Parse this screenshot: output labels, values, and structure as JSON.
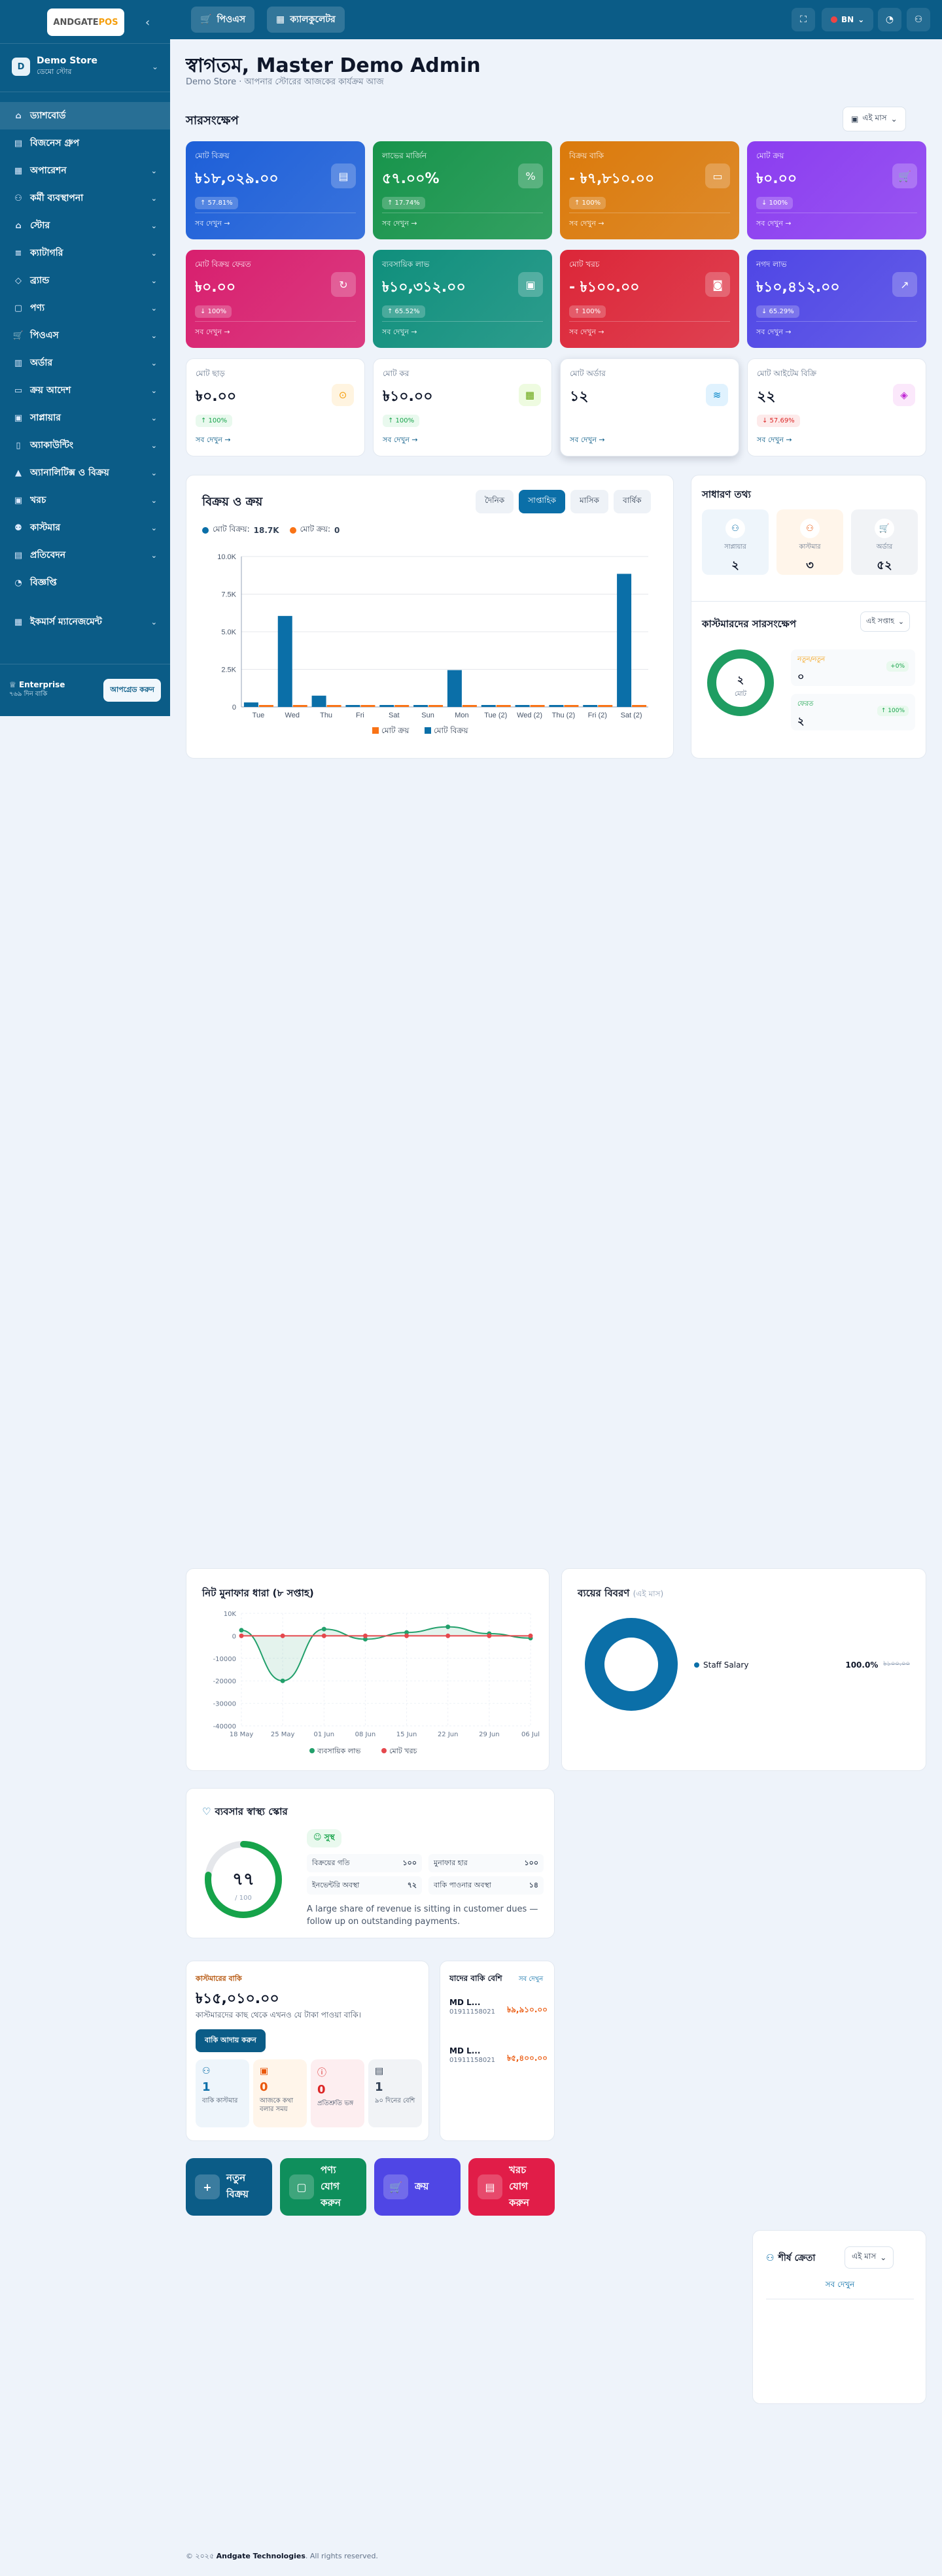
{
  "sidebar": {
    "logo_text": "ANDGATE",
    "logo_accent": "POS",
    "store": {
      "avatar": "D",
      "name": "Demo Store",
      "type": "ডেমো স্টোর"
    },
    "items": [
      {
        "label": "ড্যাশবোর্ড",
        "icon": "home-icon",
        "active": true,
        "chevron": false
      },
      {
        "label": "বিজনেস গ্রুপ",
        "icon": "building-icon",
        "chevron": false
      },
      {
        "label": "অপারেশন",
        "icon": "grid-icon",
        "chevron": true
      },
      {
        "label": "কর্মী ব্যবস্থাপনা",
        "icon": "users-icon",
        "chevron": true
      },
      {
        "label": "স্টোর",
        "icon": "store-icon",
        "chevron": true
      },
      {
        "label": "ক্যাটাগরি",
        "icon": "layers-icon",
        "chevron": true
      },
      {
        "label": "ব্র্যান্ড",
        "icon": "tag-icon",
        "chevron": true
      },
      {
        "label": "পণ্য",
        "icon": "box-icon",
        "chevron": true
      },
      {
        "label": "পিওএস",
        "icon": "cart-icon",
        "chevron": true
      },
      {
        "label": "অর্ডার",
        "icon": "clipboard-icon",
        "chevron": true
      },
      {
        "label": "ক্রয় আদেশ",
        "icon": "truck-icon",
        "chevron": true
      },
      {
        "label": "সাপ্লায়ার",
        "icon": "supplier-icon",
        "chevron": true
      },
      {
        "label": "অ্যাকাউন্টিং",
        "icon": "book-icon",
        "chevron": true
      },
      {
        "label": "অ্যানালিটিক্স ও বিক্রয়",
        "icon": "chart-icon",
        "chevron": true
      },
      {
        "label": "খরচ",
        "icon": "wallet-icon",
        "chevron": true
      },
      {
        "label": "কাস্টমার",
        "icon": "customer-icon",
        "chevron": true
      },
      {
        "label": "প্রতিবেদন",
        "icon": "report-icon",
        "chevron": true
      },
      {
        "label": "বিজ্ঞপ্তি",
        "icon": "bell-icon",
        "chevron": false
      },
      {
        "label": "ইকমার্স ম্যানেজমেন্ট",
        "icon": "ecommerce-icon",
        "chevron": true
      }
    ],
    "plan": {
      "title": "Enterprise",
      "subtitle": "৭৬৯ দিন বাকি",
      "upgrade_label": "আপগ্রেড করুন"
    }
  },
  "topbar": {
    "pos_label": "পিওএস",
    "calc_label": "ক্যালকুলেটর",
    "lang": "BN"
  },
  "header": {
    "title": "স্বাগতম, Master Demo Admin",
    "subtitle": "Demo Store · আপনার স্টোরের আজকের কার্যক্রম আজ"
  },
  "summary": {
    "title": "সারসংক্ষেপ",
    "period": "এই মাস",
    "kpis": [
      {
        "label": "মোট বিক্রয়",
        "value": "৳১৮,০২৯.০০",
        "badge": "↑ 57.81%",
        "more": "সব দেখুন →",
        "color": "#1d5fd8",
        "icon": "receipt-icon"
      },
      {
        "label": "লাভের মার্জিন",
        "value": "৫৭.০০%",
        "badge": "↑ 17.74%",
        "more": "সব দেখুন →",
        "color": "#17944b",
        "icon": "percent-icon"
      },
      {
        "label": "বিক্রয় বাকি",
        "value": "- ৳৭,৮১০.০০",
        "badge": "↑ 100%",
        "more": "সব দেখুন →",
        "color": "#db7a0b",
        "icon": "card-icon"
      },
      {
        "label": "মোট ক্রয়",
        "value": "৳০.০০",
        "badge": "↓ 100%",
        "more": "সব দেখুন →",
        "color": "#8b3df0",
        "icon": "cart-icon"
      },
      {
        "label": "মোট বিক্রয় ফেরত",
        "value": "৳০.০০",
        "badge": "↓ 100%",
        "more": "সব দেখুন →",
        "color": "#d81f6e",
        "icon": "refresh-icon"
      },
      {
        "label": "ব্যবসায়িক লাভ",
        "value": "৳১০,৩১২.০০",
        "badge": "↑ 65.52%",
        "more": "সব দেখুন →",
        "color": "#0f8f7c",
        "icon": "wallet-icon"
      },
      {
        "label": "মোট খরচ",
        "value": "- ৳১০০.০০",
        "badge": "↑ 100%",
        "more": "সব দেখুন →",
        "color": "#dc2638",
        "icon": "money-icon"
      },
      {
        "label": "নগদ লাভ",
        "value": "৳১০,৪১২.০০",
        "badge": "↓ 65.29%",
        "more": "সব দেখুন →",
        "color": "#4f46e5",
        "icon": "trend-icon"
      }
    ],
    "white_kpis": [
      {
        "label": "মোট ছাড়",
        "value": "৳০.০০",
        "badge": "↑ 100%",
        "more": "সব দেখুন →",
        "badge_bg": "#e9f9ee",
        "badge_fg": "#16a34a",
        "icon": "discount-icon",
        "icon_bg": "#fff4e0",
        "icon_fg": "#f59e0b"
      },
      {
        "label": "মোট কর",
        "value": "৳১০.০০",
        "badge": "↑ 100%",
        "more": "সব দেখুন →",
        "badge_bg": "#e9f9ee",
        "badge_fg": "#16a34a",
        "icon": "tax-icon",
        "icon_bg": "#eefbe0",
        "icon_fg": "#65a30d"
      },
      {
        "label": "মোট অর্ডার",
        "value": "১২",
        "badge": "",
        "more": "সব দেখুন →",
        "badge_bg": "",
        "badge_fg": "",
        "icon": "stack-icon",
        "icon_bg": "#e0f2fe",
        "icon_fg": "#0284c7"
      },
      {
        "label": "মোট আইটেম বিক্রি",
        "value": "২২",
        "badge": "↓ 57.69%",
        "more": "সব দেখুন →",
        "badge_bg": "#fdeaea",
        "badge_fg": "#dc2626",
        "icon": "cube-icon",
        "icon_bg": "#fbe8fb",
        "icon_fg": "#c026d3"
      }
    ]
  },
  "sales_chart": {
    "title": "বিক্রয় ও ক্রয়",
    "tabs": [
      "দৈনিক",
      "সাপ্তাহিক",
      "মাসিক",
      "বার্ষিক"
    ],
    "active_tab": 1,
    "legend_sales_label": "মোট বিক্রয়:",
    "legend_sales_value": "18.7K",
    "legend_purchase_label": "মোট ক্রয়:",
    "legend_purchase_value": "0",
    "bottom_legend_purchase": "মোট ক্রয়",
    "bottom_legend_sales": "মোট বিক্রয়"
  },
  "chart_data": [
    {
      "type": "bar",
      "categories": [
        "Tue",
        "Wed",
        "Thu",
        "Fri",
        "Sat",
        "Sun",
        "Mon",
        "Tue (2)",
        "Wed (2)",
        "Thu (2)",
        "Fri (2)",
        "Sat (2)"
      ],
      "series": [
        {
          "name": "মোট বিক্রয়",
          "values": [
            300,
            6050,
            750,
            0,
            0,
            0,
            2450,
            0,
            0,
            0,
            0,
            8850
          ],
          "color": "#0b6fa8"
        },
        {
          "name": "মোট ক্রয়",
          "values": [
            0,
            0,
            0,
            0,
            0,
            0,
            0,
            0,
            0,
            0,
            0,
            0
          ],
          "color": "#f97316"
        }
      ],
      "yticks": [
        "0",
        "2.5K",
        "5.0K",
        "7.5K",
        "10.0K"
      ],
      "ylim": [
        0,
        10000
      ]
    },
    {
      "type": "line",
      "title": "নিট মুনাফার ধারা (৮ সপ্তাহ)",
      "categories": [
        "18 May",
        "25 May",
        "01 Jun",
        "08 Jun",
        "15 Jun",
        "22 Jun",
        "29 Jun",
        "06 Jul"
      ],
      "series": [
        {
          "name": "ব্যবসায়িক লাভ",
          "values": [
            2500,
            -20000,
            3000,
            -1500,
            1500,
            4000,
            1000,
            -1000
          ],
          "color": "#22a06b"
        },
        {
          "name": "মোট খরচ",
          "values": [
            0,
            0,
            0,
            0,
            0,
            0,
            0,
            0
          ],
          "color": "#e5484d"
        }
      ],
      "yticks": [
        "-40000",
        "-30000",
        "-20000",
        "-10000",
        "0",
        "10K"
      ],
      "ylim": [
        -40000,
        10000
      ]
    },
    {
      "type": "pie",
      "title": "ব্যয়ের বিবরণ",
      "labels": [
        "Staff Salary"
      ],
      "values": [
        100
      ],
      "colors": [
        "#0b6fa8"
      ]
    }
  ],
  "general_info": {
    "title": "সাধারণ তথ্য",
    "items": [
      {
        "label": "সাপ্লায়ার",
        "value": "২",
        "icon": "users-icon",
        "bg": "#eef5fb",
        "fg": "#0b6fa8"
      },
      {
        "label": "কাস্টমার",
        "value": "৩",
        "icon": "user-plus-icon",
        "bg": "#fff5ea",
        "fg": "#ea580c"
      },
      {
        "label": "অর্ডার",
        "value": "৫২",
        "icon": "cart-icon",
        "bg": "#f1f3f6",
        "fg": "#64748b"
      }
    ]
  },
  "customer_summary": {
    "title": "কাস্টমারদের সারসংক্ষেপ",
    "period": "এই সপ্তাহ",
    "total": "২",
    "total_label": "মোট",
    "rows": [
      {
        "label": "নতুন/নতুন",
        "value": "০",
        "badge": "+0%",
        "color": "#f59e0b"
      },
      {
        "label": "ফেরত",
        "value": "২",
        "badge": "↑ 100%",
        "color": "#16a34a"
      }
    ]
  },
  "profit_trend": {
    "title": "নিট মুনাফার ধারা (৮ সপ্তাহ)",
    "legend_profit": "ব্যবসায়িক লাভ",
    "legend_expense": "মোট খরচ"
  },
  "expense_breakdown": {
    "title": "ব্যয়ের বিবরণ",
    "period": "(এই মাস)",
    "item_label": "Staff Salary",
    "item_percent": "100.0%",
    "item_amount": "৳১০০.০০"
  },
  "health": {
    "title": "ব্যবসার স্বাস্থ্য স্কোর",
    "score": "৭৭",
    "score_sub": "/ 100",
    "status": "সুস্থ",
    "metrics": [
      {
        "label": "বিক্রয়ের গতি",
        "value": "১০০"
      },
      {
        "label": "মুনাফার হার",
        "value": "১০০"
      },
      {
        "label": "ইনভেন্টরি অবস্থা",
        "value": "৭২"
      },
      {
        "label": "বাকি পাওনার অবস্থা",
        "value": "১৪"
      }
    ],
    "note": "A large share of revenue is sitting in customer dues — follow up on outstanding payments."
  },
  "dues": {
    "tag": "কাস্টমারের বাকি",
    "amount": "৳১৫,০১০.০০",
    "desc": "কাস্টমারদের কাছ থেকে এখনও যে টাকা পাওয়া বাকি।",
    "button": "বাকি আদায় করুন",
    "stats": [
      {
        "value": "1",
        "label": "বাকি কাস্টমার",
        "bg": "#eef5fb",
        "fg": "#0b6fa8",
        "icon": "user-icon"
      },
      {
        "value": "0",
        "label": "আজকে কথা বলার সময়",
        "bg": "#fff5ea",
        "fg": "#ea580c",
        "icon": "calendar-icon"
      },
      {
        "value": "0",
        "label": "প্রতিশ্রুতি ভঙ্গ",
        "bg": "#fdeef0",
        "fg": "#dc2626",
        "icon": "alert-icon"
      },
      {
        "value": "1",
        "label": "৯০ দিনের বেশি",
        "bg": "#f1f3f6",
        "fg": "#334155",
        "icon": "archive-icon"
      }
    ]
  },
  "top_dues": {
    "title": "যাদের বাকি বেশি",
    "link": "সব দেখুন",
    "rows": [
      {
        "name": "MD L...",
        "phone": "01911158021",
        "amount": "৳৯,৯১০.০০"
      },
      {
        "name": "MD L...",
        "phone": "01911158021",
        "amount": "৳৫,৪০০.০০"
      }
    ]
  },
  "quick_actions": [
    {
      "label": "নতুন বিক্রয়",
      "icon": "plus-icon",
      "color": "#0b5c87"
    },
    {
      "label": "পণ্য যোগ করুন",
      "icon": "box-icon",
      "color": "#0f8f5c"
    },
    {
      "label": "ক্রয়",
      "icon": "cart-icon",
      "color": "#4f46e5"
    },
    {
      "label": "খরচ যোগ করুন",
      "icon": "receipt-icon",
      "color": "#e11d48"
    }
  ],
  "top_customers": {
    "title": "শীর্ষ ক্রেতা",
    "period": "এই মাস",
    "link": "সব দেখুন"
  },
  "footer": {
    "prefix": "© ২০২৫",
    "company": "Andgate Technologies",
    "suffix": ". All rights reserved."
  }
}
